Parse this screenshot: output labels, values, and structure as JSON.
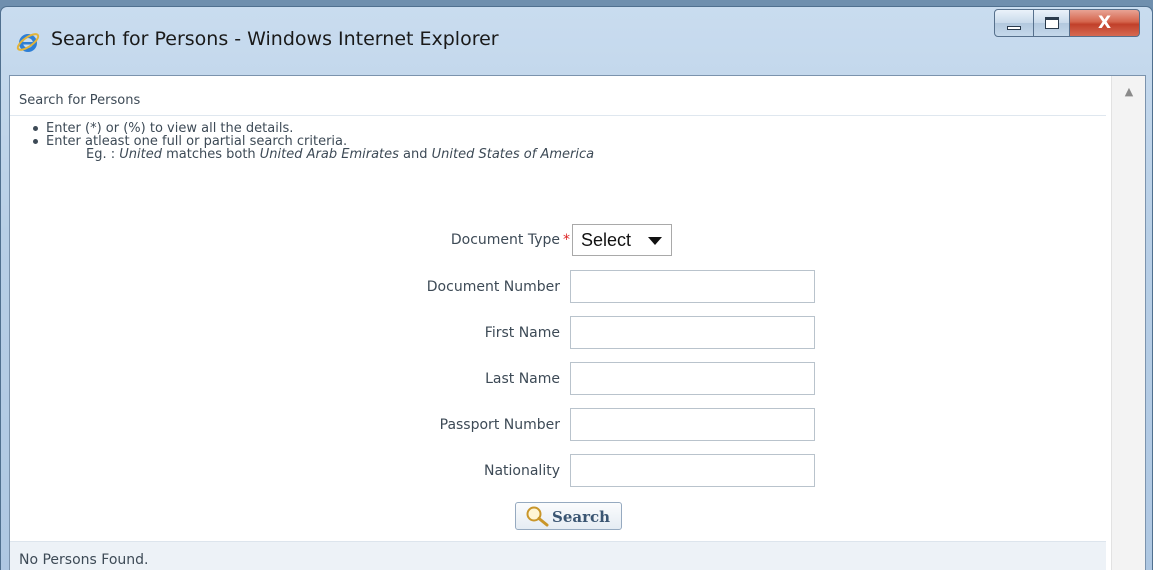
{
  "window": {
    "title": "Search for Persons - Windows Internet Explorer",
    "close_label": "X"
  },
  "section": {
    "header": "Search for Persons"
  },
  "hints": {
    "line1": "Enter (*) or (%) to view all the details.",
    "line2": "Enter atleast one full or partial search criteria.",
    "eg_prefix": "Eg. : ",
    "eg_term": "United",
    "eg_mid": " matches both ",
    "eg_match1": "United Arab Emirates",
    "eg_and": " and ",
    "eg_match2": "United States of America"
  },
  "form": {
    "document_type": {
      "label": "Document Type",
      "required_mark": "*",
      "selected": "Select"
    },
    "document_number": {
      "label": "Document Number",
      "value": ""
    },
    "first_name": {
      "label": "First Name",
      "value": ""
    },
    "last_name": {
      "label": "Last Name",
      "value": ""
    },
    "passport_number": {
      "label": "Passport Number",
      "value": ""
    },
    "nationality": {
      "label": "Nationality",
      "value": ""
    },
    "search_label": "Search"
  },
  "results": {
    "message": "No Persons Found."
  },
  "colors": {
    "required": "#dd2222",
    "title_close": "#c1402a",
    "results_bg": "#edf2f7"
  }
}
